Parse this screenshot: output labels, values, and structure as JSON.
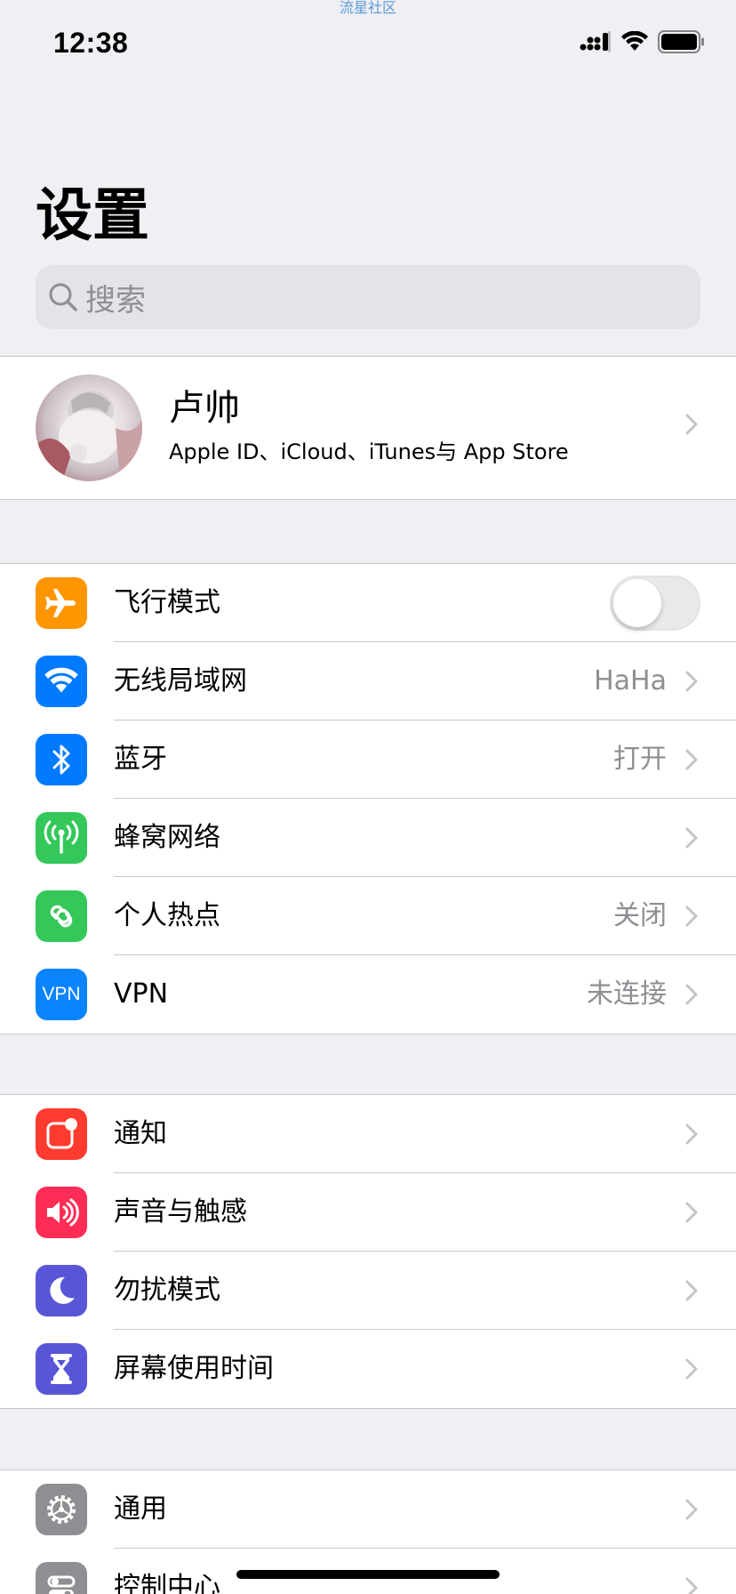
{
  "watermark": "流星社区",
  "status_bar": {
    "time": "12:38",
    "signal_icon": "cellular-signal-icon",
    "wifi_icon": "wifi-icon",
    "battery_icon": "battery-icon"
  },
  "header": {
    "title": "设置"
  },
  "search": {
    "placeholder": "搜索",
    "icon": "search-icon"
  },
  "profile": {
    "name": "卢帅",
    "subtitle": "Apple ID、iCloud、iTunes与 App Store"
  },
  "connectivity": [
    {
      "label": "飞行模式",
      "value": "",
      "icon": "airplane-icon",
      "color": "#ff9500",
      "control": "toggle",
      "toggle_on": false
    },
    {
      "label": "无线局域网",
      "value": "HaHa",
      "icon": "wifi-icon",
      "color": "#007aff"
    },
    {
      "label": "蓝牙",
      "value": "打开",
      "icon": "bluetooth-icon",
      "color": "#007aff"
    },
    {
      "label": "蜂窝网络",
      "value": "",
      "icon": "cellular-antenna-icon",
      "color": "#34c759"
    },
    {
      "label": "个人热点",
      "value": "关闭",
      "icon": "hotspot-icon",
      "color": "#34c759"
    },
    {
      "label": "VPN",
      "value": "未连接",
      "icon": "vpn-icon",
      "icon_text": "VPN",
      "color": "#0a84ff"
    }
  ],
  "notifications": [
    {
      "label": "通知",
      "icon": "notifications-icon",
      "color": "#ff3b30"
    },
    {
      "label": "声音与触感",
      "icon": "speaker-icon",
      "color": "#ff2d55"
    },
    {
      "label": "勿扰模式",
      "icon": "moon-icon",
      "color": "#5856d6"
    },
    {
      "label": "屏幕使用时间",
      "icon": "hourglass-icon",
      "color": "#5856d6"
    }
  ],
  "general": [
    {
      "label": "通用",
      "icon": "gear-icon",
      "color": "#8e8e93"
    },
    {
      "label": "控制中心",
      "icon": "control-center-icon",
      "color": "#8e8e93"
    }
  ]
}
